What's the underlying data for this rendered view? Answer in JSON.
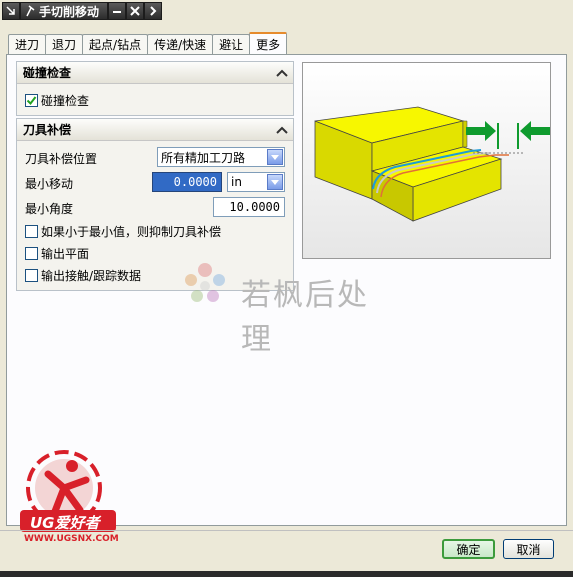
{
  "window": {
    "title": "手切削移动"
  },
  "tabs": [
    {
      "label": "进刀"
    },
    {
      "label": "退刀"
    },
    {
      "label": "起点/钻点"
    },
    {
      "label": "传递/快速"
    },
    {
      "label": "避让"
    },
    {
      "label": "更多"
    }
  ],
  "collision_group": {
    "title": "碰撞检查",
    "checkbox_label": "碰撞检查",
    "checked": true
  },
  "tool_comp_group": {
    "title": "刀具补偿",
    "position_label": "刀具补偿位置",
    "position_value": "所有精加工刀路",
    "min_move_label": "最小移动",
    "min_move_value": "0.0000",
    "min_move_unit": "in",
    "min_angle_label": "最小角度",
    "min_angle_value": "10.0000",
    "opt_suppress_label": "如果小于最小值，则抑制刀具补偿",
    "opt_output_plane_label": "输出平面",
    "opt_output_contact_label": "输出接触/跟踪数据"
  },
  "watermark": {
    "text": "若枫后处理"
  },
  "logo": {
    "brand": "UG爱好者",
    "url": "WWW.UGSNX.COM"
  },
  "footer": {
    "ok_label": "确定",
    "cancel_label": "取消"
  },
  "colors": {
    "accent_tab": "#e68b2c",
    "highlight": "#316ac5",
    "block_yellow": "#f2f200",
    "arrow_green": "#0f9b2e",
    "logo_red": "#d8202a"
  }
}
